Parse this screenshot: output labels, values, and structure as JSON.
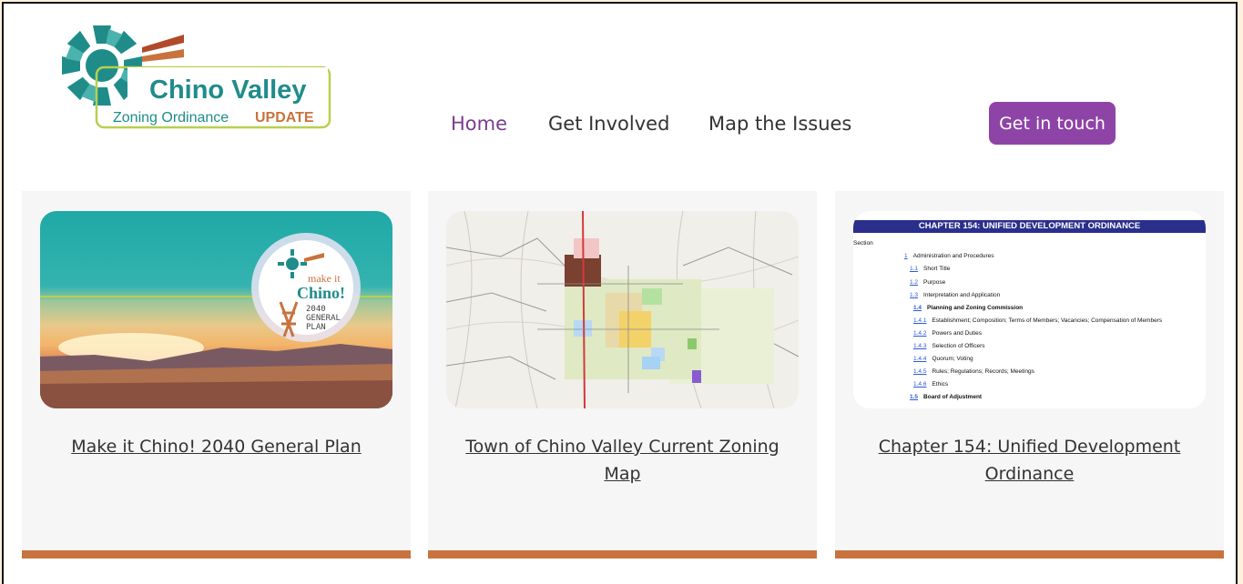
{
  "brand": {
    "name": "Chino Valley",
    "tagline_prefix": "Zoning Ordinance",
    "tagline_emphasis": "UPDATE",
    "colors": {
      "teal": "#1f8c8a",
      "green": "#b7d04f",
      "rust": "#c8733e",
      "purple": "#8e44a6"
    }
  },
  "nav": {
    "items": [
      {
        "label": "Home",
        "active": true
      },
      {
        "label": "Get Involved",
        "active": false
      },
      {
        "label": "Map the Issues",
        "active": false
      }
    ],
    "cta_label": "Get in touch"
  },
  "cards": [
    {
      "caption": "Make it Chino! 2040 General Plan",
      "badge": {
        "line1": "make it",
        "line2": "Chino!",
        "line3": "2040",
        "line4": "GENERAL",
        "line5": "PLAN"
      }
    },
    {
      "caption": "Town of Chino Valley Current Zoning Map"
    },
    {
      "caption": "Chapter 154: Unified Development Ordinance",
      "doc": {
        "title": "CHAPTER 154: UNIFIED DEVELOPMENT ORDINANCE",
        "section_label": "Section",
        "entries": [
          {
            "num": "1",
            "text": "Administration and Procedures",
            "bold": false
          },
          {
            "num": "1.1",
            "text": "Short Title",
            "bold": false
          },
          {
            "num": "1.2",
            "text": "Purpose",
            "bold": false
          },
          {
            "num": "1.3",
            "text": "Interpretation and Application",
            "bold": false
          },
          {
            "num": "1.4",
            "text": "Planning and Zoning Commission",
            "bold": true
          },
          {
            "num": "1.4.1",
            "text": "Establishment; Composition; Terms of Members; Vacancies; Compensation of Members",
            "bold": false
          },
          {
            "num": "1.4.2",
            "text": "Powers and Duties",
            "bold": false
          },
          {
            "num": "1.4.3",
            "text": "Selection of Officers",
            "bold": false
          },
          {
            "num": "1.4.4",
            "text": "Quorum; Voting",
            "bold": false
          },
          {
            "num": "1.4.5",
            "text": "Rules; Regulations; Records; Meetings",
            "bold": false
          },
          {
            "num": "1.4.6",
            "text": "Ethics",
            "bold": false
          },
          {
            "num": "1.5",
            "text": "Board of Adjustment",
            "bold": true
          }
        ]
      }
    }
  ]
}
